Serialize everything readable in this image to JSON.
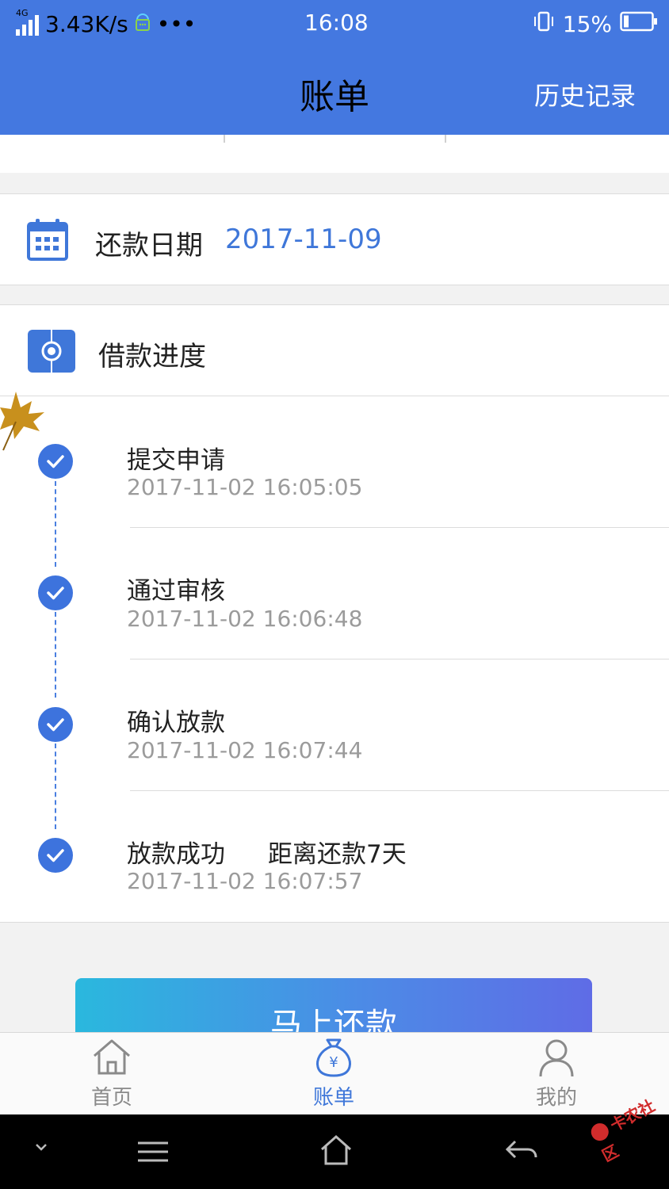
{
  "status": {
    "network": "4G",
    "speed": "3.43K/s",
    "more": "•••",
    "time": "16:08",
    "battery": "15%"
  },
  "header": {
    "title": "账单",
    "history": "历史记录"
  },
  "repay_date": {
    "label": "还款日期",
    "value": "2017-11-09"
  },
  "progress": {
    "title": "借款进度",
    "steps": [
      {
        "title": "提交申请",
        "time": "2017-11-02 16:05:05",
        "extra": ""
      },
      {
        "title": "通过审核",
        "time": "2017-11-02 16:06:48",
        "extra": ""
      },
      {
        "title": "确认放款",
        "time": "2017-11-02 16:07:44",
        "extra": ""
      },
      {
        "title": "放款成功",
        "time": "2017-11-02 16:07:57",
        "extra": "距离还款7天"
      }
    ]
  },
  "pay_button": "马上还款",
  "tabbar": {
    "home": "首页",
    "bill": "账单",
    "mine": "我的"
  },
  "colors": {
    "header": "#4478e0",
    "accent": "#3f77d9"
  },
  "watermark": "卡农社区"
}
